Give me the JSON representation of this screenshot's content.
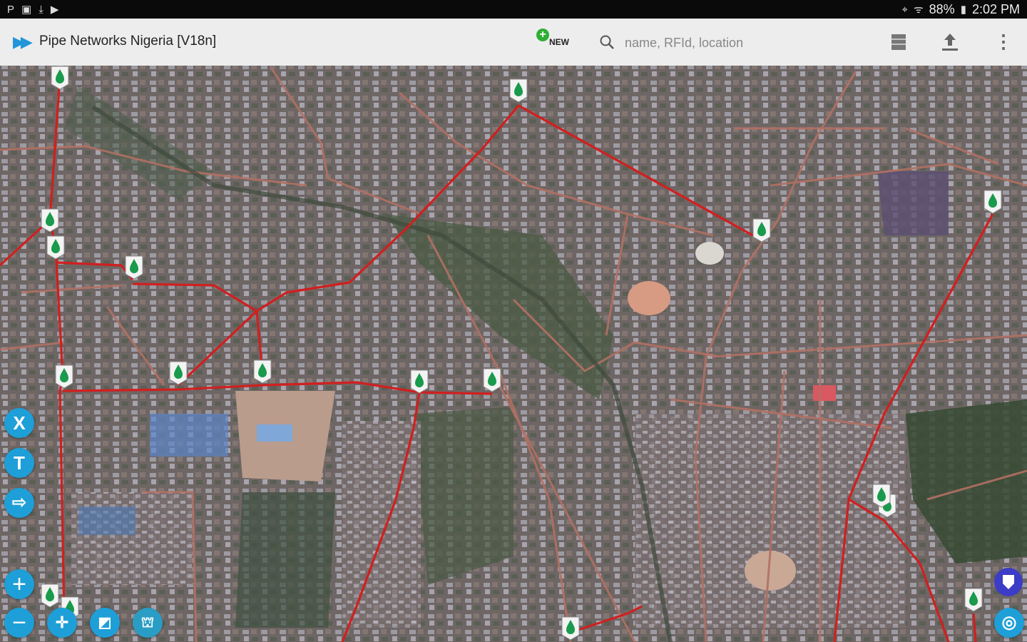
{
  "status_bar": {
    "battery": "88%",
    "time": "2:02 PM"
  },
  "toolbar": {
    "title": "Pipe Networks Nigeria [V18n]",
    "new_label": "NEW",
    "search_placeholder": "name, RFId, location"
  },
  "map": {
    "pipe_color": "#d11f1f",
    "marker_color": "#1a9a4c"
  },
  "side_tools": {
    "x_label": "X",
    "t_label": "T"
  }
}
